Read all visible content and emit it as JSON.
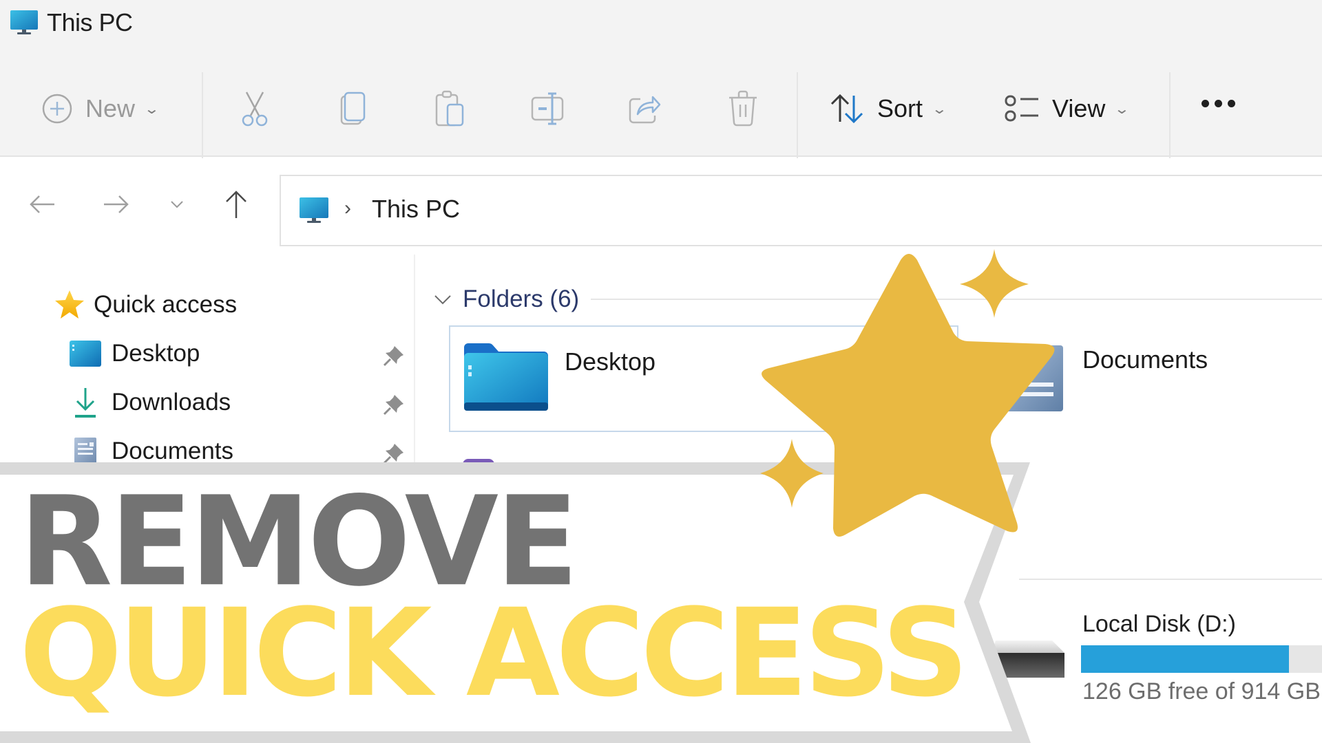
{
  "window": {
    "title": "This PC",
    "title_icon": "monitor-icon"
  },
  "toolbar": {
    "new_label": "New",
    "new_icon": "plus-circle-icon",
    "actions": [
      {
        "name": "cut",
        "icon": "scissors-icon",
        "enabled": false
      },
      {
        "name": "copy",
        "icon": "copy-icon",
        "enabled": false
      },
      {
        "name": "paste",
        "icon": "clipboard-icon",
        "enabled": false
      },
      {
        "name": "rename",
        "icon": "rename-icon",
        "enabled": false
      },
      {
        "name": "share",
        "icon": "share-icon",
        "enabled": false
      },
      {
        "name": "delete",
        "icon": "trash-icon",
        "enabled": false
      }
    ],
    "sort_label": "Sort",
    "sort_icon": "sort-arrows-icon",
    "view_label": "View",
    "view_icon": "view-list-icon",
    "more_icon": "more-ellipsis-icon"
  },
  "navigation": {
    "back_icon": "arrow-left-icon",
    "forward_icon": "arrow-right-icon",
    "recent_icon": "chevron-down-icon",
    "up_icon": "arrow-up-icon",
    "breadcrumb": [
      {
        "icon": "monitor-icon"
      },
      {
        "label": "This PC"
      }
    ]
  },
  "sidebar": {
    "items": [
      {
        "label": "Quick access",
        "icon": "star-icon",
        "pinned": false
      },
      {
        "label": "Desktop",
        "icon": "desktop-folder-icon",
        "pinned": true
      },
      {
        "label": "Downloads",
        "icon": "download-icon",
        "pinned": true
      },
      {
        "label": "Documents",
        "icon": "documents-icon",
        "pinned": true
      }
    ]
  },
  "main": {
    "folders_group": {
      "title": "Folders (6)",
      "items": [
        {
          "name": "Desktop",
          "icon": "desktop-folder-icon",
          "selected": true
        },
        {
          "name": "Documents",
          "icon": "documents-icon",
          "selected": false
        }
      ]
    },
    "drives": [
      {
        "name": "Local Disk (D:)",
        "free_text": "126 GB free of 914 GB",
        "free_gb": 126,
        "total_gb": 914,
        "bar_color": "#26a0da"
      }
    ]
  },
  "overlay": {
    "headline_line1": "REMOVE",
    "headline_line2": "QUICK ACCESS",
    "line1_color": "#737373",
    "line2_color": "#fcdc5c",
    "star_color": "#e9b942",
    "banner_border_color": "#d9d9d9"
  }
}
